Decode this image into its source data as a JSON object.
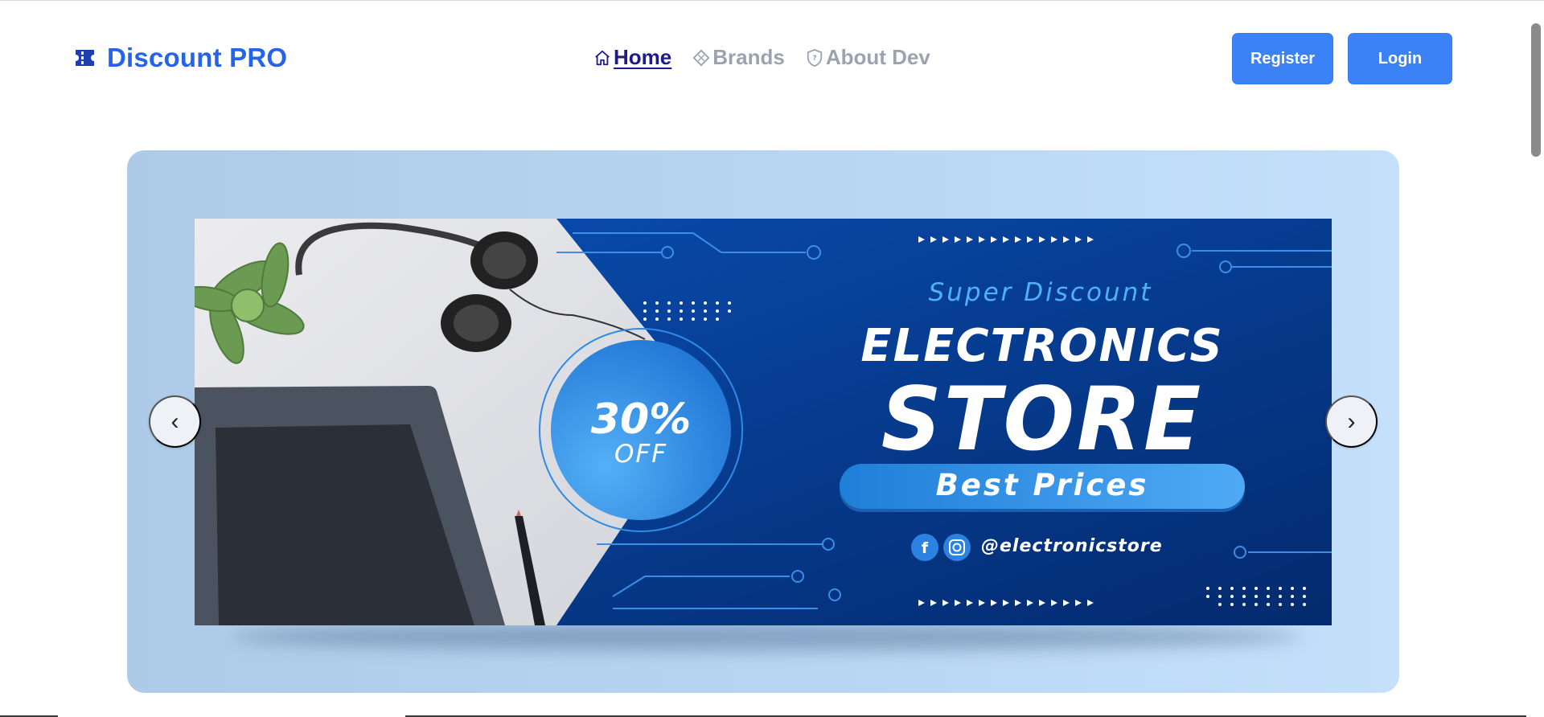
{
  "header": {
    "brand": "Discount PRO",
    "nav": [
      {
        "label": "Home",
        "icon": "home-icon",
        "active": true
      },
      {
        "label": "Brands",
        "icon": "diamond-icon",
        "active": false
      },
      {
        "label": "About Dev",
        "icon": "shield-icon",
        "active": false
      }
    ],
    "register_label": "Register",
    "login_label": "Login"
  },
  "carousel": {
    "prev_label": "‹",
    "next_label": "›",
    "banner": {
      "super": "Super Discount",
      "headline_1": "ELECTRONICS",
      "headline_2": "STORE",
      "tagline": "Best Prices",
      "discount_pct": "30%",
      "discount_word": "OFF",
      "handle": "@electronicstore"
    }
  },
  "colors": {
    "brand": "#2563eb",
    "button": "#3b82f6",
    "nav_active": "#1e1b8a",
    "nav_inactive": "#9ca3af",
    "banner_bg": "#083e94"
  }
}
